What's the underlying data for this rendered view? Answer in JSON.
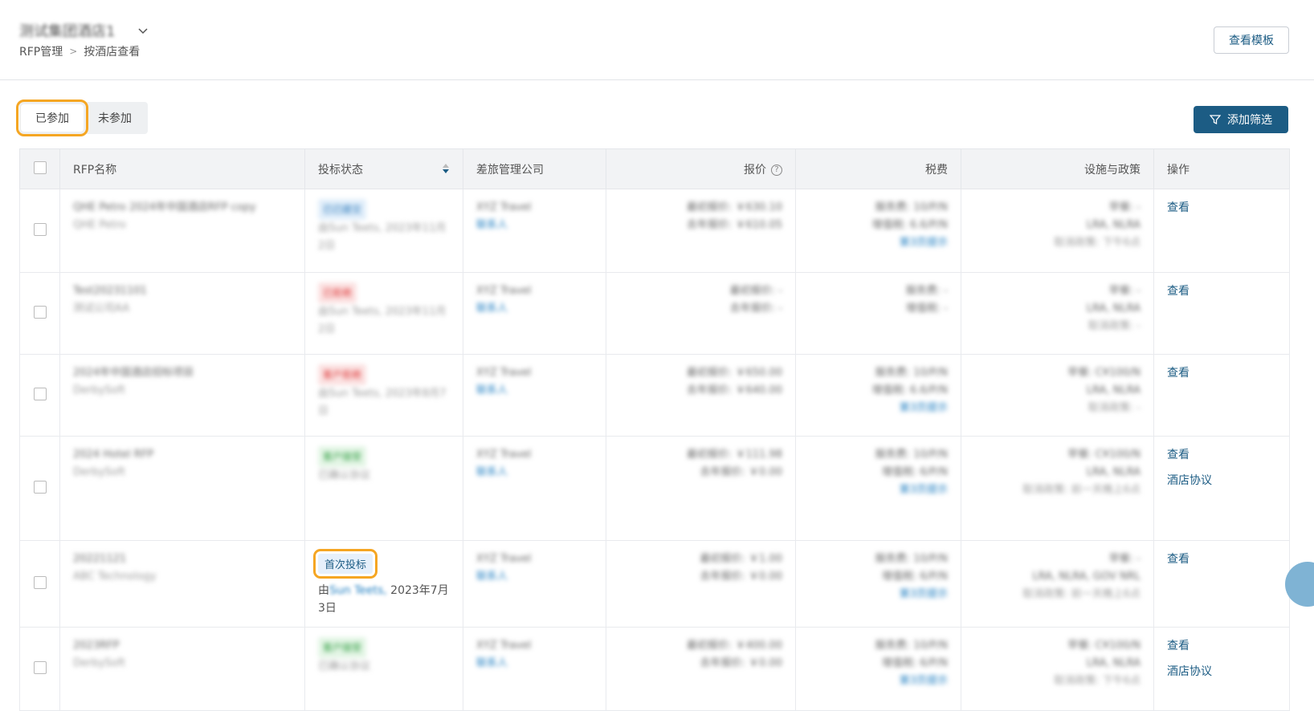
{
  "header": {
    "hotel_name": "测试集团酒店1",
    "breadcrumb": [
      "RFP管理",
      "按酒店查看"
    ],
    "template_button": "查看模板"
  },
  "tabs": {
    "joined": "已参加",
    "not_joined": "未参加"
  },
  "filter_button": "添加筛选",
  "table": {
    "columns": [
      "RFP名称",
      "投标状态",
      "差旅管理公司",
      "报价",
      "税费",
      "设施与政策",
      "操作"
    ],
    "rows": [
      {
        "name": "QHE Petro 2024年中国酒店RFP copy",
        "client": "QHE Petro",
        "status": "已已提交",
        "status_color": "blue",
        "by": "由Sun Teets, 2023年11月2日",
        "tmc": "XYZ Travel",
        "contact": "联系人",
        "price1": "最初报价: ￥630.10",
        "price2": "去年报价: ￥610.05",
        "tax1": "服务费: 10/P/N",
        "tax2": "增值税: 6.6/P/N",
        "tax3": "第3页提示",
        "fac1": "早餐: -",
        "fac2": "LRA, NLRA",
        "fac3": "取消政策: 下午6点",
        "ops": [
          "查看"
        ]
      },
      {
        "name": "Test20231101",
        "client": "测试公司AA",
        "status": "已拒绝",
        "status_color": "red",
        "by": "由Sun Teets, 2023年11月2日",
        "tmc": "XYZ Travel",
        "contact": "联系人",
        "price1": "最初报价: -",
        "price2": "去年报价: -",
        "tax1": "服务费: -",
        "tax2": "增值税: -",
        "tax3": "",
        "fac1": "早餐: -",
        "fac2": "LRA, NLRA",
        "fac3": "取消政策: -",
        "ops": [
          "查看"
        ]
      },
      {
        "name": "2024年中国酒店招标项目",
        "client": "DerbySoft",
        "status": "客户拒绝",
        "status_color": "red",
        "by": "由Sun Teets, 2023年8月7日",
        "tmc": "XYZ Travel",
        "contact": "联系人",
        "price1": "最初报价: ￥650.00",
        "price2": "去年报价: ￥640.00",
        "tax1": "服务费: 10/P/N",
        "tax2": "增值税: 6.6/P/N",
        "tax3": "第3页提示",
        "fac1": "早餐: C¥100/N",
        "fac2": "LRA, NLRA",
        "fac3": "取消政策: -",
        "ops": [
          "查看"
        ]
      },
      {
        "name": "2024 Hotel RFP",
        "client": "DerbySoft",
        "status": "客户接受",
        "status_color": "green",
        "by": "已确认协议",
        "tmc": "XYZ Travel",
        "contact": "联系人",
        "price1": "最初报价: ￥111.98",
        "price2": "去年报价: ￥0.00",
        "tax1": "服务费: 10/P/N",
        "tax2": "增值税: 6/P/N",
        "tax3": "第3页提示",
        "fac1": "早餐: C¥100/N",
        "fac2": "LRA, NLRA",
        "fac3": "取消政策: 前一天晚上6点",
        "ops": [
          "查看",
          "酒店协议"
        ]
      },
      {
        "name": "20221121",
        "client": "ABC Technology",
        "status": "首次投标",
        "status_color": "blue",
        "by_prefix": "由",
        "by_name": "Sun Teets,",
        "by_date": " 2023年7月3日",
        "tmc": "XYZ Travel",
        "contact": "联系人",
        "price1": "最初报价: ￥1.00",
        "price2": "去年报价: ￥0.00",
        "tax1": "服务费: 10/P/N",
        "tax2": "增值税: 6/P/N",
        "tax3": "第3页提示",
        "fac1": "早餐: -",
        "fac2": "LRA, NLRA, GOV NRL",
        "fac3": "取消政策: 前一天晚上6点",
        "ops": [
          "查看"
        ]
      },
      {
        "name": "2023RFP",
        "client": "DerbySoft",
        "status": "客户接受",
        "status_color": "green",
        "by": "已确认协议",
        "tmc": "XYZ Travel",
        "contact": "联系人",
        "price1": "最初报价: ￥400.00",
        "price2": "去年报价: ￥0.00",
        "tax1": "服务费: 10/P/N",
        "tax2": "增值税: 6/P/N",
        "tax3": "第3页提示",
        "fac1": "早餐: C¥100/N",
        "fac2": "LRA, NLRA",
        "fac3": "取消政策: 下午6点",
        "ops": [
          "查看",
          "酒店协议"
        ]
      }
    ]
  }
}
